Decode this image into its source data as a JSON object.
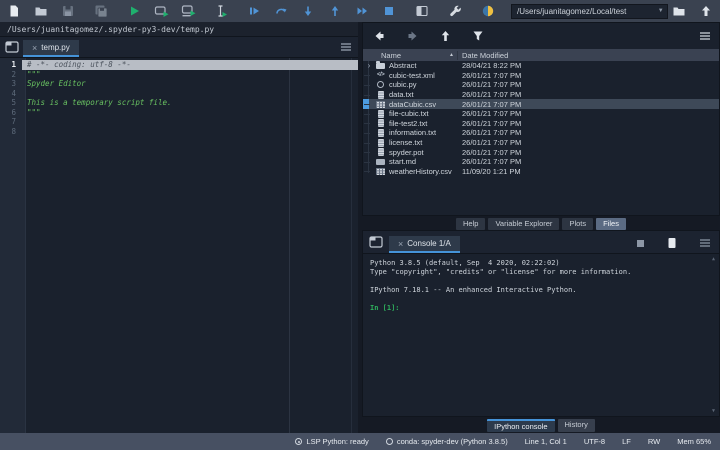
{
  "toolbar": {
    "path_value": "/Users/juanitagomez/Local/test",
    "icons": [
      "new-file-icon",
      "open-file-icon",
      "save-icon",
      "save-all-icon",
      "run-icon",
      "run-cell-icon",
      "run-cell-advance-icon",
      "run-selection-icon",
      "debug-icon",
      "step-over-icon",
      "step-into-icon",
      "step-return-icon",
      "continue-icon",
      "stop-icon",
      "maximize-pane-icon",
      "preferences-icon",
      "python-path-icon",
      "browse-directory-icon",
      "parent-directory-icon"
    ]
  },
  "editor": {
    "breadcrumb": "/Users/juanitagomez/.spyder-py3-dev/temp.py",
    "tab_label": "temp.py",
    "close_glyph": "×",
    "lines": [
      {
        "n": "1",
        "text": "# -*- coding: utf-8 -*-",
        "cls": "comment current"
      },
      {
        "n": "2",
        "text": "\"\"\"",
        "cls": "str"
      },
      {
        "n": "3",
        "text": "Spyder Editor",
        "cls": "str"
      },
      {
        "n": "4",
        "text": "",
        "cls": ""
      },
      {
        "n": "5",
        "text": "This is a temporary script file.",
        "cls": "str"
      },
      {
        "n": "6",
        "text": "\"\"\"",
        "cls": "str"
      },
      {
        "n": "7",
        "text": "",
        "cls": ""
      },
      {
        "n": "8",
        "text": "",
        "cls": ""
      }
    ]
  },
  "files": {
    "header": {
      "name": "Name",
      "date": "Date Modified",
      "sort_glyph": "▲"
    },
    "rows": [
      {
        "name": "Abstract",
        "date": "28/04/21 8:22 PM",
        "icon": "folder-icon",
        "cls": "dir",
        "expand": "›"
      },
      {
        "name": "cubic-test.xml",
        "date": "26/01/21 7:07 PM",
        "icon": "xml-file-icon",
        "cls": ""
      },
      {
        "name": "cubic.py",
        "date": "26/01/21 7:07 PM",
        "icon": "python-file-icon",
        "cls": ""
      },
      {
        "name": "data.txt",
        "date": "26/01/21 7:07 PM",
        "icon": "text-file-icon",
        "cls": ""
      },
      {
        "name": "dataCubic.csv",
        "date": "26/01/21 7:07 PM",
        "icon": "csv-file-icon",
        "cls": "sel"
      },
      {
        "name": "file-cubic.txt",
        "date": "26/01/21 7:07 PM",
        "icon": "text-file-icon",
        "cls": ""
      },
      {
        "name": "file-test2.txt",
        "date": "26/01/21 7:07 PM",
        "icon": "text-file-icon",
        "cls": ""
      },
      {
        "name": "information.txt",
        "date": "26/01/21 7:07 PM",
        "icon": "text-file-icon",
        "cls": ""
      },
      {
        "name": "license.txt",
        "date": "26/01/21 7:07 PM",
        "icon": "text-file-icon",
        "cls": ""
      },
      {
        "name": "spyder.pot",
        "date": "26/01/21 7:07 PM",
        "icon": "pot-file-icon",
        "cls": ""
      },
      {
        "name": "start.md",
        "date": "26/01/21 7:07 PM",
        "icon": "markdown-file-icon",
        "cls": ""
      },
      {
        "name": "weatherHistory.csv",
        "date": "11/09/20 1:21 PM",
        "icon": "csv-file-icon",
        "cls": ""
      }
    ]
  },
  "panel_tabs": [
    {
      "label": "Help",
      "cls": ""
    },
    {
      "label": "Variable Explorer",
      "cls": ""
    },
    {
      "label": "Plots",
      "cls": ""
    },
    {
      "label": "Files",
      "cls": "active"
    }
  ],
  "console": {
    "tab_label": "Console 1/A",
    "close_glyph": "×",
    "lines": [
      "Python 3.8.5 (default, Sep  4 2020, 02:22:02)",
      "Type \"copyright\", \"credits\" or \"license\" for more information.",
      "",
      "IPython 7.18.1 -- An enhanced Interactive Python.",
      ""
    ],
    "prompt": "In [1]:",
    "scroll_up_glyph": "▲",
    "scroll_down_glyph": "▼"
  },
  "console_tabs": [
    {
      "label": "IPython console",
      "cls": "active"
    },
    {
      "label": "History",
      "cls": ""
    }
  ],
  "statusbar": {
    "items": [
      {
        "icon": "lsp-icon",
        "label": "LSP Python: ready"
      },
      {
        "icon": "conda-icon",
        "label": "conda: spyder-dev (Python 3.8.5)"
      },
      {
        "label": "Line 1, Col 1"
      },
      {
        "label": "UTF-8"
      },
      {
        "label": "LF"
      },
      {
        "label": "RW"
      },
      {
        "label": "Mem 65%"
      }
    ]
  }
}
